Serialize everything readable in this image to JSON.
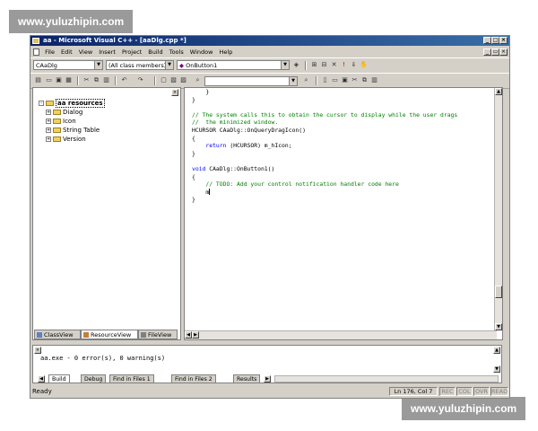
{
  "watermark": "www.yuluzhipin.com",
  "window": {
    "title": "aa - Microsoft Visual C++ - [aaDlg.cpp *]"
  },
  "menu": [
    "File",
    "Edit",
    "View",
    "Insert",
    "Project",
    "Build",
    "Tools",
    "Window",
    "Help"
  ],
  "toolbar": {
    "class_combo": "CAaDlg",
    "members_combo": "(All class members)",
    "function_combo": "OnButton1"
  },
  "workspace": {
    "tree": [
      {
        "label": "aa resources",
        "expander": "-",
        "level": 0,
        "selected": true
      },
      {
        "label": "Dialog",
        "expander": "+",
        "level": 1
      },
      {
        "label": "Icon",
        "expander": "+",
        "level": 1
      },
      {
        "label": "String Table",
        "expander": "+",
        "level": 1
      },
      {
        "label": "Version",
        "expander": "+",
        "level": 1
      }
    ],
    "tabs": [
      "ClassView",
      "ResourceView",
      "FileView"
    ]
  },
  "editor": {
    "lines": [
      {
        "text": "    }",
        "type": "code"
      },
      {
        "text": "}",
        "type": "code"
      },
      {
        "text": "",
        "type": "code"
      },
      {
        "text": "// The system calls this to obtain the cursor to display while the user drags",
        "type": "comment"
      },
      {
        "text": "//  the minimized window.",
        "type": "comment"
      },
      {
        "text": "HCURSOR CAaDlg::OnQueryDragIcon()",
        "type": "code"
      },
      {
        "text": "{",
        "type": "code"
      },
      {
        "text": "    return (HCURSOR) m_hIcon;",
        "type": "return"
      },
      {
        "text": "}",
        "type": "code"
      },
      {
        "text": "",
        "type": "code"
      },
      {
        "text": "void CAaDlg::OnButton1()",
        "type": "void"
      },
      {
        "text": "{",
        "type": "code"
      },
      {
        "text": "    // TODO: Add your control notification handler code here",
        "type": "comment"
      },
      {
        "text": "    m",
        "type": "caret"
      },
      {
        "text": "}",
        "type": "code"
      }
    ]
  },
  "output": {
    "text": "aa.exe - 0 error(s), 0 warning(s)",
    "tabs": [
      "Build",
      "Debug",
      "Find in Files 1",
      "Find in Files 2",
      "Results"
    ]
  },
  "status": {
    "text": "Ready",
    "position": "Ln 176, Col 7",
    "indicators": [
      "REC",
      "COL",
      "OVR",
      "READ"
    ]
  }
}
